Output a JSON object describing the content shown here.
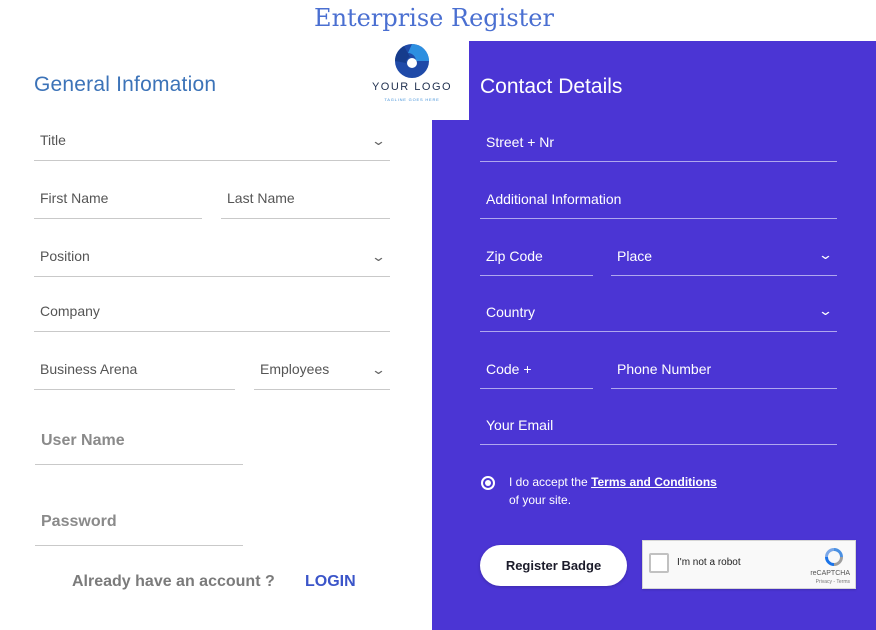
{
  "page_title": "Enterprise Register",
  "logo": {
    "text": "YOUR LOGO",
    "tagline": "TAGLINE GOES HERE"
  },
  "general": {
    "heading": "General Infomation",
    "title": "Title",
    "first_name": "First Name",
    "last_name": "Last Name",
    "position": "Position",
    "company": "Company",
    "business_arena": "Business Arena",
    "employees": "Employees",
    "user_name": "User Name",
    "password": "Password"
  },
  "account": {
    "already": "Already have an account ?",
    "login": "LOGIN"
  },
  "contact": {
    "heading": "Contact Details",
    "street": "Street + Nr",
    "additional": "Additional Information",
    "zip": "Zip Code",
    "place": "Place",
    "country": "Country",
    "code": "Code +",
    "phone": "Phone Number",
    "email": "Your Email"
  },
  "terms": {
    "prefix": "I do accept the ",
    "link": "Terms and Conditions",
    "suffix": "of your site."
  },
  "register_label": "Register Badge",
  "captcha": {
    "label": "I'm not a robot",
    "brand": "reCAPTCHA",
    "privacy": "Privacy - Terms"
  },
  "colors": {
    "accent_panel": "#4b35d4",
    "heading_blue": "#3c73b8",
    "title_blue": "#4a6fd1",
    "login_blue": "#3b55c9"
  },
  "icons": {
    "select_arrow": "chevron-down-icon",
    "logo": "logo-mark-icon",
    "captcha": "recaptcha-icon",
    "radio": "radio-selected-icon"
  }
}
